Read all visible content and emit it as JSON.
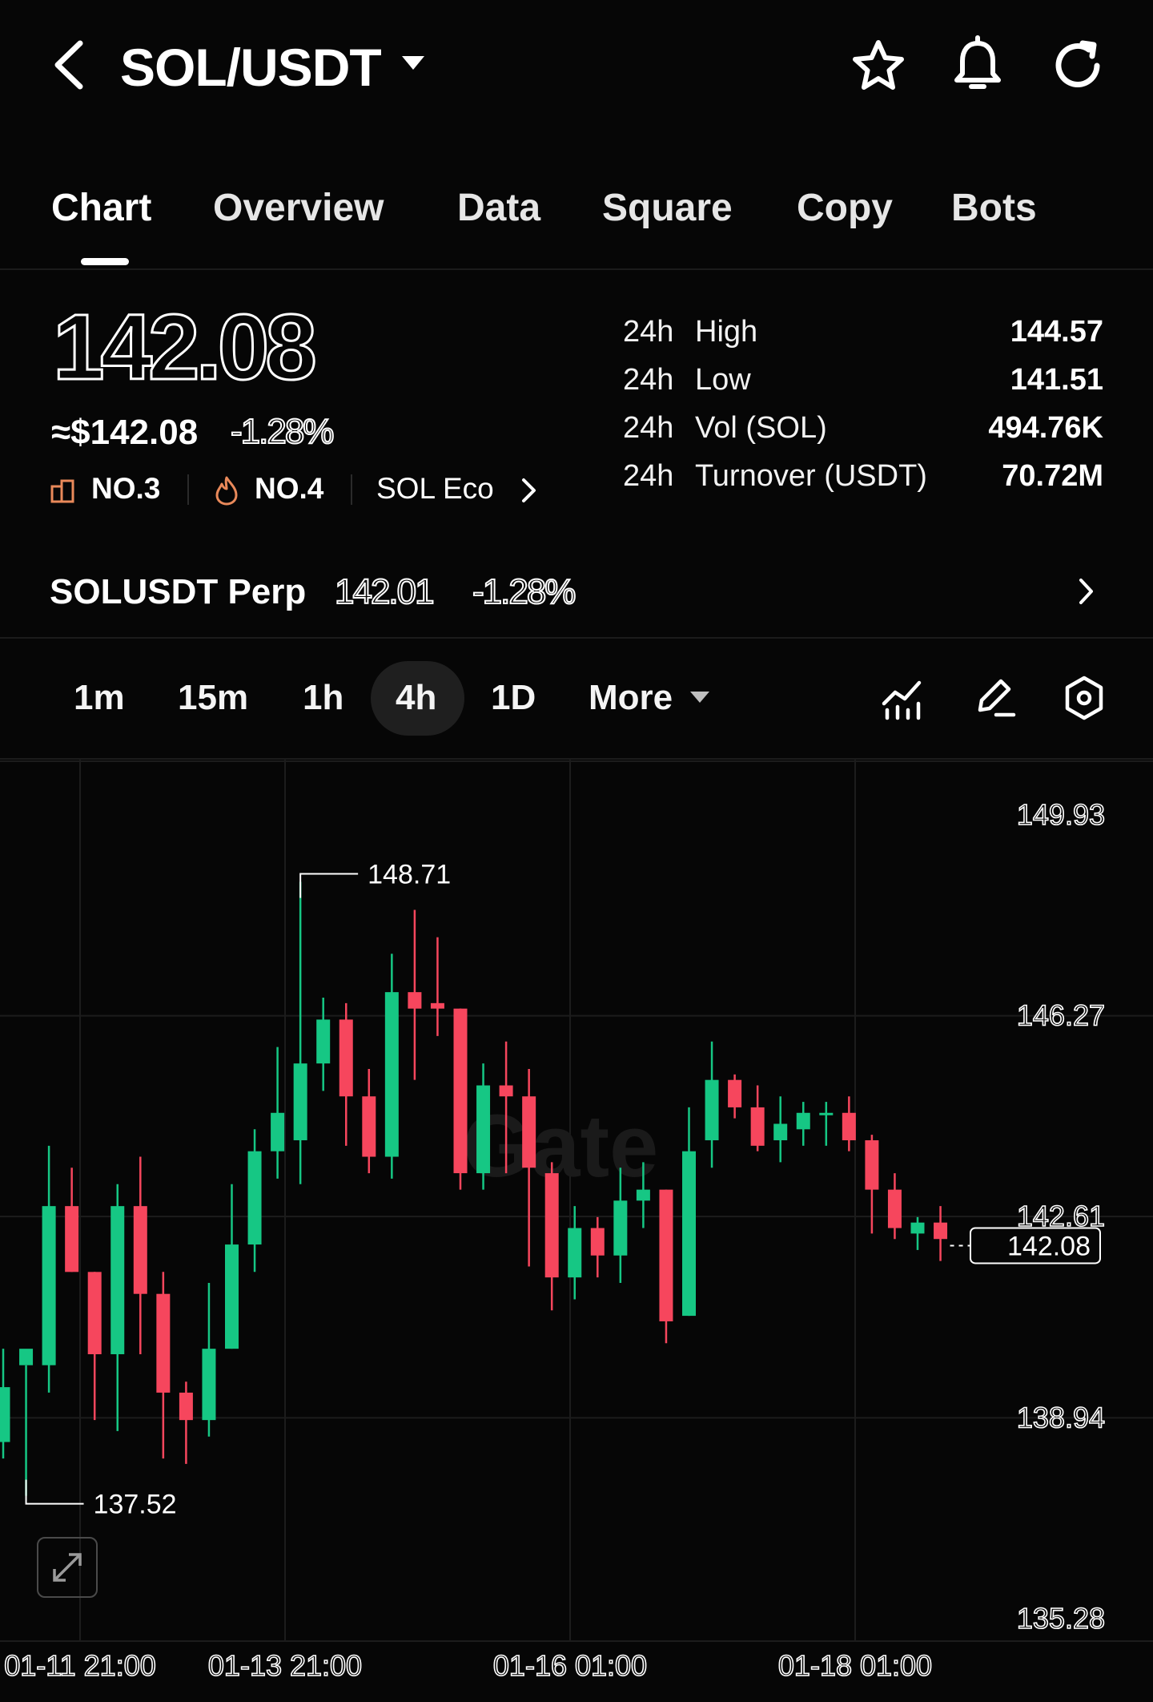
{
  "header": {
    "pair": "SOL/USDT",
    "icons": [
      "back-icon",
      "star-icon",
      "bell-icon",
      "refresh-icon"
    ]
  },
  "tabs": [
    "Chart",
    "Overview",
    "Data",
    "Square",
    "Copy",
    "Bots"
  ],
  "active_tab": "Chart",
  "price": {
    "last": "142.08",
    "usd": "≈$142.08",
    "change_pct": "-1.28%",
    "rank1": "NO.3",
    "rank2": "NO.4",
    "eco": "SOL Eco"
  },
  "stats": [
    {
      "period": "24h",
      "label": "High",
      "value": "144.57"
    },
    {
      "period": "24h",
      "label": "Low",
      "value": "141.51"
    },
    {
      "period": "24h",
      "label": "Vol (SOL)",
      "value": "494.76K"
    },
    {
      "period": "24h",
      "label": "Turnover (USDT)",
      "value": "70.72M"
    }
  ],
  "perp": {
    "name": "SOLUSDT Perp",
    "price": "142.01",
    "change_pct": "-1.28%"
  },
  "intervals": [
    "1m",
    "15m",
    "1h",
    "4h",
    "1D",
    "More"
  ],
  "active_interval": "4h",
  "colors": {
    "up": "#16c784",
    "down": "#f6465d",
    "background": "#060606"
  },
  "chart_data": {
    "type": "candlestick",
    "y_ticks": [
      "149.93",
      "146.27",
      "142.61",
      "138.94",
      "135.28"
    ],
    "x_ticks": [
      "01-11 21:00",
      "01-13 21:00",
      "01-16 01:00",
      "01-18 01:00"
    ],
    "max_label": "148.71",
    "min_label": "137.52",
    "current_price": "142.08",
    "candles": [
      {
        "o": 138.5,
        "c": 139.5,
        "h": 140.2,
        "l": 138.2
      },
      {
        "o": 139.9,
        "c": 140.2,
        "h": 139.9,
        "l": 137.52
      },
      {
        "o": 139.9,
        "c": 142.8,
        "h": 143.9,
        "l": 139.4
      },
      {
        "o": 142.8,
        "c": 141.6,
        "h": 143.5,
        "l": 141.6
      },
      {
        "o": 141.6,
        "c": 140.1,
        "h": 141.6,
        "l": 138.9
      },
      {
        "o": 140.1,
        "c": 142.8,
        "h": 143.2,
        "l": 138.7
      },
      {
        "o": 142.8,
        "c": 141.2,
        "h": 143.7,
        "l": 140.1
      },
      {
        "o": 141.2,
        "c": 139.4,
        "h": 141.6,
        "l": 138.2
      },
      {
        "o": 139.4,
        "c": 138.9,
        "h": 139.6,
        "l": 138.1
      },
      {
        "o": 138.9,
        "c": 140.2,
        "h": 141.4,
        "l": 138.6
      },
      {
        "o": 140.2,
        "c": 142.1,
        "h": 143.2,
        "l": 140.2
      },
      {
        "o": 142.1,
        "c": 143.8,
        "h": 144.2,
        "l": 141.6
      },
      {
        "o": 143.8,
        "c": 144.5,
        "h": 145.7,
        "l": 143.3
      },
      {
        "o": 144.0,
        "c": 145.4,
        "h": 148.71,
        "l": 143.2
      },
      {
        "o": 145.4,
        "c": 146.2,
        "h": 146.6,
        "l": 144.9
      },
      {
        "o": 146.2,
        "c": 144.8,
        "h": 146.5,
        "l": 143.9
      },
      {
        "o": 144.8,
        "c": 143.7,
        "h": 145.3,
        "l": 143.4
      },
      {
        "o": 143.7,
        "c": 146.7,
        "h": 147.4,
        "l": 143.3
      },
      {
        "o": 146.7,
        "c": 146.4,
        "h": 148.2,
        "l": 145.1
      },
      {
        "o": 146.5,
        "c": 146.4,
        "h": 147.7,
        "l": 145.9
      },
      {
        "o": 146.4,
        "c": 143.4,
        "h": 146.4,
        "l": 143.1
      },
      {
        "o": 143.4,
        "c": 145.0,
        "h": 145.4,
        "l": 143.1
      },
      {
        "o": 145.0,
        "c": 144.8,
        "h": 145.8,
        "l": 143.4
      },
      {
        "o": 144.8,
        "c": 143.5,
        "h": 145.3,
        "l": 141.7
      },
      {
        "o": 143.4,
        "c": 141.5,
        "h": 143.6,
        "l": 140.9
      },
      {
        "o": 141.5,
        "c": 142.4,
        "h": 142.8,
        "l": 141.1
      },
      {
        "o": 142.4,
        "c": 141.9,
        "h": 142.6,
        "l": 141.5
      },
      {
        "o": 141.9,
        "c": 142.9,
        "h": 143.5,
        "l": 141.4
      },
      {
        "o": 142.9,
        "c": 143.1,
        "h": 143.6,
        "l": 142.4
      },
      {
        "o": 143.1,
        "c": 140.7,
        "h": 143.1,
        "l": 140.3
      },
      {
        "o": 140.8,
        "c": 143.8,
        "h": 144.6,
        "l": 140.8
      },
      {
        "o": 144.0,
        "c": 145.1,
        "h": 145.8,
        "l": 143.5
      },
      {
        "o": 145.1,
        "c": 144.6,
        "h": 145.2,
        "l": 144.4
      },
      {
        "o": 144.6,
        "c": 143.9,
        "h": 145.0,
        "l": 143.8
      },
      {
        "o": 144.0,
        "c": 144.3,
        "h": 144.8,
        "l": 143.6
      },
      {
        "o": 144.2,
        "c": 144.5,
        "h": 144.7,
        "l": 143.9
      },
      {
        "o": 144.5,
        "c": 144.5,
        "h": 144.7,
        "l": 143.9
      },
      {
        "o": 144.5,
        "c": 144.0,
        "h": 144.8,
        "l": 143.8
      },
      {
        "o": 144.0,
        "c": 143.1,
        "h": 144.1,
        "l": 142.3
      },
      {
        "o": 143.1,
        "c": 142.4,
        "h": 143.4,
        "l": 142.2
      },
      {
        "o": 142.3,
        "c": 142.5,
        "h": 142.6,
        "l": 142.0
      },
      {
        "o": 142.5,
        "c": 142.2,
        "h": 142.8,
        "l": 141.8
      }
    ]
  }
}
